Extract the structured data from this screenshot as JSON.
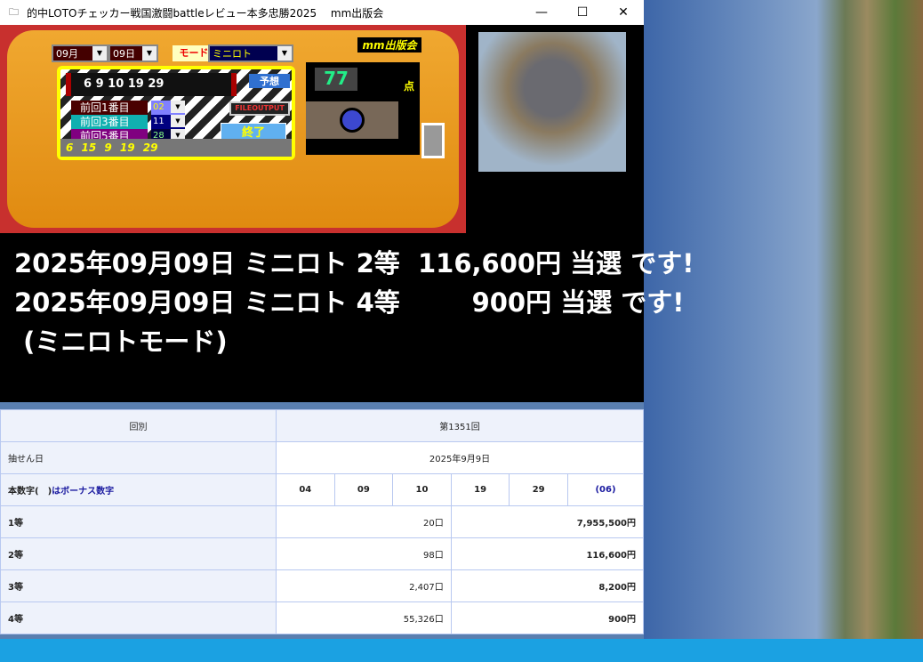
{
  "window": {
    "title": "的中LOTOチェッカー戦国激闘battleレビュー本多忠勝2025　 mm出版会",
    "minimize": "—",
    "maximize": "☐",
    "close": "✕"
  },
  "device": {
    "month": "09月",
    "day": "09日",
    "mode_label": "モード",
    "mode": "ミニロト",
    "brand": "mm出版会",
    "prediction": "6 9 10 19 29",
    "predict_button": "予想",
    "file_output_button": "FILEOUTPUT",
    "exit_button": "終了",
    "previous": [
      {
        "label": "前回1番目",
        "value": "02",
        "bg": "#4a0000",
        "selbg": "#8080ff",
        "selfg": "#ff0"
      },
      {
        "label": "前回3番目",
        "value": "11",
        "bg": "#10b0b0",
        "selbg": "#000080",
        "selfg": "#fff"
      },
      {
        "label": "前回5番目",
        "value": "28",
        "bg": "#800080",
        "selbg": "#000040",
        "selfg": "#8f8"
      }
    ],
    "last_numbers": "6 15 9 19 29",
    "score": "77",
    "score_unit": "点"
  },
  "result": {
    "lines": [
      "2025年09月09日 ミニロト 2等  116,600円 当選 です!",
      "2025年09月09日 ミニロト 4等        900円 当選 です!",
      " (ミニロトモード)"
    ]
  },
  "table": {
    "round_label": "回別",
    "round": "第1351回",
    "date_label": "抽せん日",
    "date": "2025年9月9日",
    "numbers_label_a": "本数字(　)",
    "numbers_label_b": "はボーナス数字",
    "numbers": [
      "04",
      "09",
      "10",
      "19",
      "29"
    ],
    "bonus": "(06)",
    "prizes": [
      {
        "rank": "1等",
        "count": "20口",
        "amount": "7,955,500円"
      },
      {
        "rank": "2等",
        "count": "98口",
        "amount": "116,600円"
      },
      {
        "rank": "3等",
        "count": "2,407口",
        "amount": "8,200円"
      },
      {
        "rank": "4等",
        "count": "55,326口",
        "amount": "900円"
      }
    ]
  }
}
